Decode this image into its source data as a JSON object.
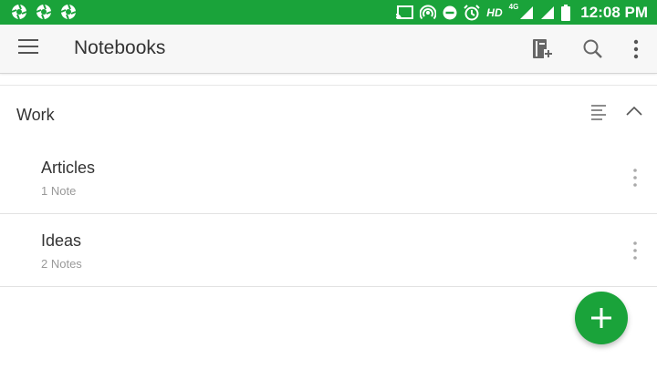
{
  "status_bar": {
    "left_icons": [
      "aperture-icon",
      "aperture-icon",
      "aperture-icon"
    ],
    "right_icons": [
      "cast-icon",
      "hotspot-icon",
      "do-not-disturb-icon",
      "alarm-icon",
      "signal-icon",
      "signal-icon",
      "battery-icon"
    ],
    "hd_label": "HD",
    "network_label": "4G",
    "time": "12:08 PM"
  },
  "toolbar": {
    "title": "Notebooks",
    "icons": [
      "hamburger-menu-icon",
      "new-notebook-icon",
      "search-icon",
      "more-vert-icon"
    ]
  },
  "stack": {
    "name": "Work",
    "sort_icon": "sort-icon",
    "collapse_icon": "chevron-up-icon"
  },
  "notebooks": [
    {
      "name": "Articles",
      "count": "1 Note"
    },
    {
      "name": "Ideas",
      "count": "2 Notes"
    }
  ],
  "fab_icon": "plus-icon",
  "colors": {
    "brand_green": "#1aa33a",
    "toolbar_bg": "#f7f7f7",
    "secondary_text": "#999999"
  }
}
